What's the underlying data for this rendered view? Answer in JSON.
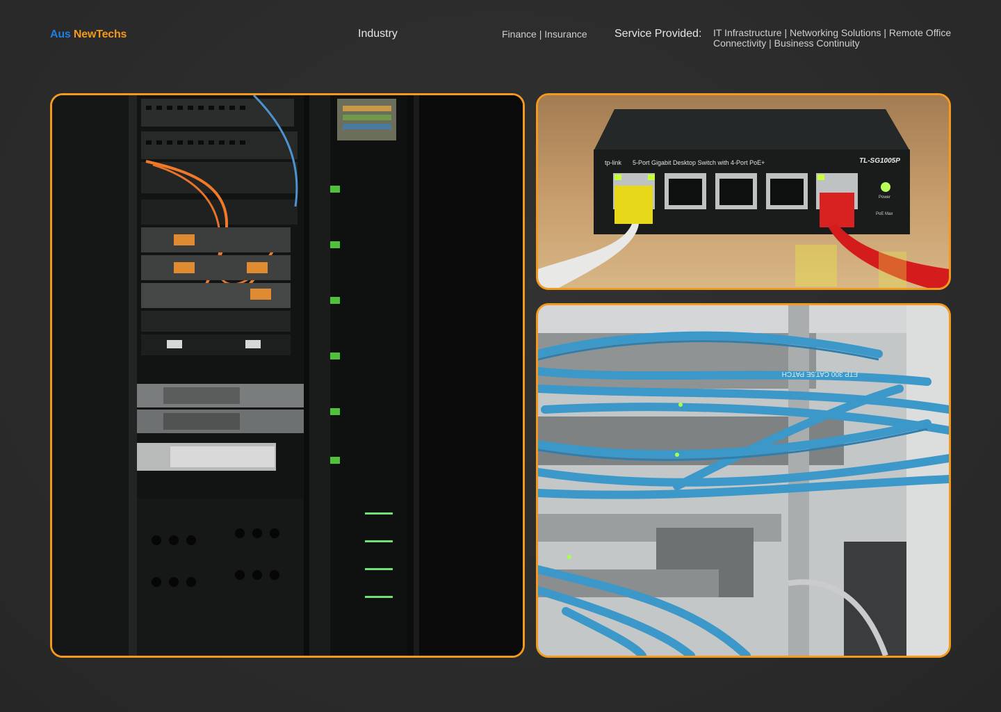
{
  "header": {
    "brand_part1": "Aus",
    "brand_part2": "NewTechs",
    "industry_label": "Industry",
    "industry_value": "Finance | Insurance",
    "service_label": "Service Provided:",
    "service_value": "IT Infrastructure | Networking Solutions | Remote Office Connectivity | Business Continuity"
  },
  "images": {
    "switch": {
      "brand_text": "tp-link",
      "desc_text": "5-Port Gigabit Desktop Switch with 4-Port PoE+",
      "model_text": "TL-SG1005P",
      "power_label": "Power",
      "poe_label": "PoE Max"
    },
    "cables": {
      "cable_text": "FTP 300 CAT.5E PATCH"
    }
  },
  "colors": {
    "accent": "#f39a1e",
    "brand_blue": "#1f7fe0",
    "background": "#2c2c2c"
  }
}
